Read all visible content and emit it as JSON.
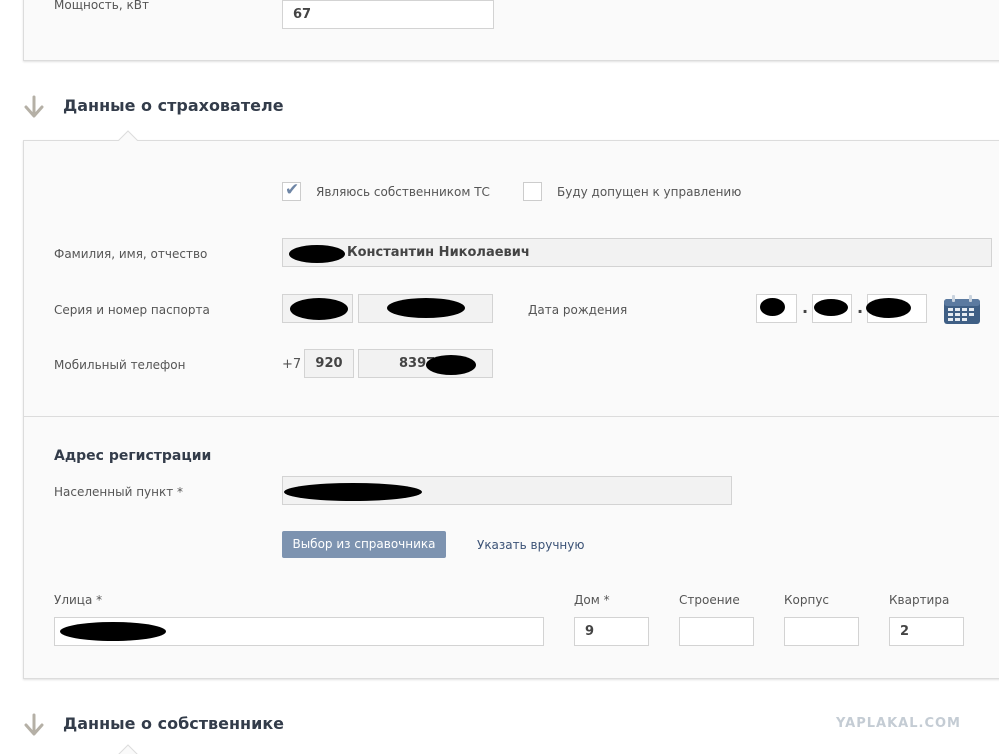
{
  "vehicle": {
    "power_label": "Мощность, кВт",
    "power_value": "67"
  },
  "insurer_section": {
    "title": "Данные о страхователе",
    "is_owner_label": "Являюсь собственником ТС",
    "is_owner_checked": true,
    "will_drive_label": "Буду допущен к управлению",
    "will_drive_checked": false,
    "fio_label": "Фамилия, имя, отчество",
    "fio_value": "Константин Николаевич",
    "passport_label": "Серия и номер паспорта",
    "birth_label": "Дата рождения",
    "phone_label": "Мобильный телефон",
    "phone_prefix": "+7",
    "phone_code": "920",
    "phone_number": "8397",
    "dob_separator": "."
  },
  "address": {
    "title": "Адрес регистрации",
    "locality_label": "Населенный пункт *",
    "directory_button": "Выбор из справочника",
    "manual_link": "Указать вручную",
    "street_label": "Улица *",
    "house_label": "Дом *",
    "house_value": "9",
    "building_label": "Строение",
    "building_value": "",
    "korpus_label": "Корпус",
    "korpus_value": "",
    "apartment_label": "Квартира",
    "apartment_value": "2"
  },
  "owner_section": {
    "title": "Данные о собственнике"
  },
  "watermark": "YAPLAKAL.COM",
  "icons": {
    "section_arrow": "arrow-down-icon",
    "check": "checkmark-icon",
    "calendar": "calendar-icon"
  },
  "colors": {
    "button_bg": "#7d93b0",
    "checkmark": "#6f86a6",
    "link": "#3b5276",
    "title": "#333c4a"
  }
}
